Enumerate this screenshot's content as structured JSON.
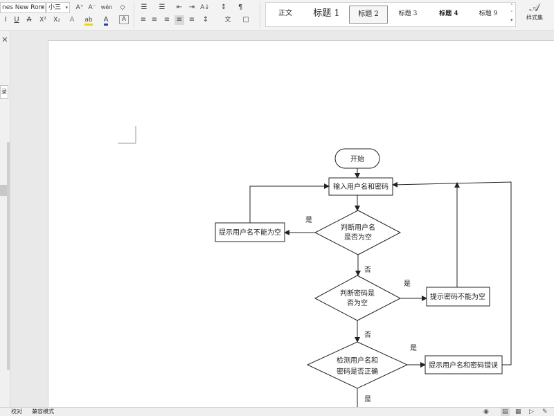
{
  "toolbar": {
    "font_name": "nes New Roma",
    "font_size": "小三",
    "grow_font": "A⁺",
    "shrink_font": "A⁻",
    "phonetic": "wén",
    "clear_format": "◇",
    "italic": "I",
    "underline": "U",
    "strike": "A",
    "superscript": "X²",
    "subscript": "X₂",
    "text_effect": "A",
    "highlight": "ab",
    "font_color": "A",
    "char_border": "A",
    "bullets": "☰",
    "numbering": "☰",
    "decrease_indent": "⇤",
    "increase_indent": "⇥",
    "sort": "A↓",
    "show_marks": "¶",
    "align_left": "≡",
    "align_center": "≡",
    "align_right": "≡",
    "justify": "≡",
    "distributed": "≡",
    "line_spacing": "↕",
    "asian_layout": "文",
    "borders": "□",
    "highlight_color": "#f5d400",
    "font_color_value": "#1f3fbf"
  },
  "styles": {
    "items": [
      "正文",
      "标题 1",
      "标题 2",
      "标题 3",
      "标题 4",
      "标题 9"
    ],
    "style_set_label": "样式集"
  },
  "leftpane": {
    "close": "✕",
    "tab": "录"
  },
  "flowchart": {
    "start": "开始",
    "input": "输入用户名和密码",
    "check_user_1": "判断用户名",
    "check_user_2": "是否为空",
    "user_empty": "提示用户名不能为空",
    "check_pwd_1": "判断密码是",
    "check_pwd_2": "否为空",
    "pwd_empty": "提示密码不能为空",
    "verify_1": "检测用户名和",
    "verify_2": "密码是否正确",
    "wrong": "提示用户名和密码错误",
    "yes": "是",
    "no": "否"
  },
  "statusbar": {
    "proofread": "校对",
    "compat_mode": "兼容模式"
  }
}
